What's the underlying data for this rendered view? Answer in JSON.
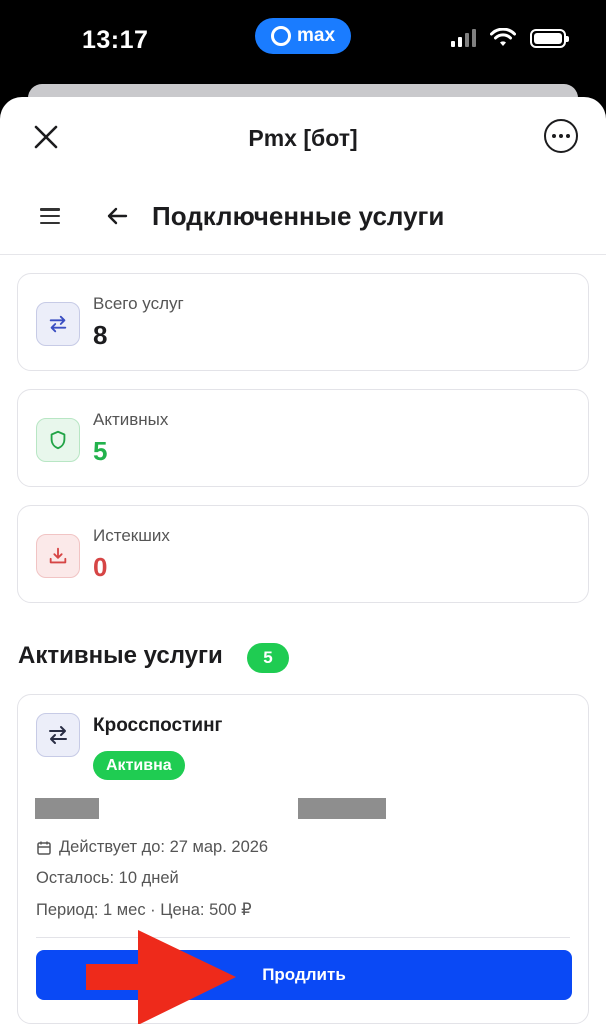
{
  "status_bar": {
    "time": "13:17",
    "app_name": "max"
  },
  "sheet": {
    "title": "Pmx [бот]"
  },
  "page": {
    "title": "Подключенные услуги"
  },
  "stats": [
    {
      "label": "Всего услуг",
      "value": "8",
      "icon": "swap-arrows-icon",
      "color": "#1c1c1e",
      "icon_color": "#3b4fc2",
      "icon_bg": "#eceef9",
      "icon_border": "#c7cbe6"
    },
    {
      "label": "Активных",
      "value": "5",
      "icon": "shield-icon",
      "color": "#22b24c",
      "icon_color": "#22a447",
      "icon_bg": "#e8f7ec",
      "icon_border": "#b8e6c4"
    },
    {
      "label": "Истекших",
      "value": "0",
      "icon": "download-tray-icon",
      "color": "#d64545",
      "icon_color": "#d64545",
      "icon_bg": "#fbe9e9",
      "icon_border": "#f1c4c4"
    }
  ],
  "active_section": {
    "title": "Активные услуги",
    "count": "5"
  },
  "service": {
    "name": "Кросспостинг",
    "status": "Активна",
    "valid_until": "Действует до: 27 мар. 2026",
    "remaining": "Осталось: 10 дней",
    "period_price": "Период: 1 мес · Цена: 500 ₽",
    "action": "Продлить"
  },
  "colors": {
    "accent": "#0a49f5",
    "success": "#1fcc52",
    "danger": "#d64545",
    "annotation_arrow": "#ee2a1b"
  }
}
